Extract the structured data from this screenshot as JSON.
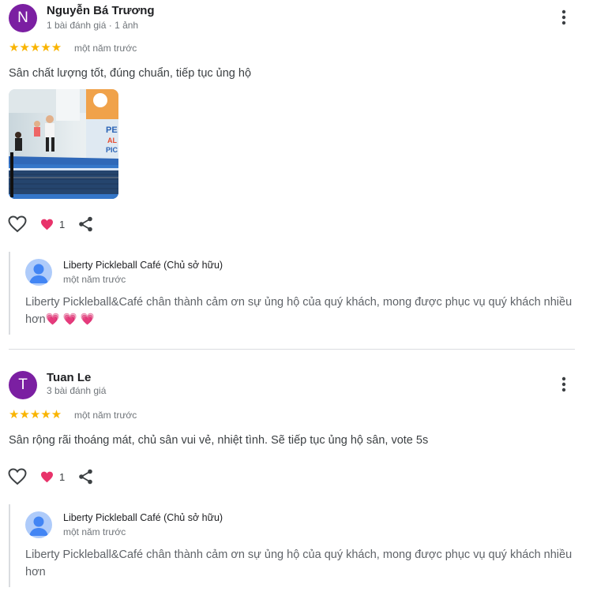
{
  "colors": {
    "avatar_bg": "#7b1fa2",
    "star": "#f9b400",
    "heart": "#e8336a",
    "owner_avatar_bg": "#aecbfa",
    "owner_avatar_fg": "#4285f4"
  },
  "reviews": [
    {
      "avatar_letter": "N",
      "author": "Nguyễn Bá Trương",
      "meta": "1 bài đánh giá · 1 ảnh",
      "rating": 5,
      "stars": "★★★★★",
      "time": "một năm trước",
      "text": "Sân chất lượng tốt, đúng chuẩn, tiếp tục ủng hộ",
      "has_photo": true,
      "reaction_count": "1",
      "reply": {
        "owner": "Liberty Pickleball Café (Chủ sở hữu)",
        "time": "một năm trước",
        "text": "Liberty Pickleball&Café chân thành cảm ơn sự ủng hộ của quý khách, mong được phục vụ quý khách nhiều hơn💗 💗 💗"
      }
    },
    {
      "avatar_letter": "T",
      "author": "Tuan Le",
      "meta": "3 bài đánh giá",
      "rating": 5,
      "stars": "★★★★★",
      "time": "một năm trước",
      "text": "Sân rộng rãi thoáng mát, chủ sân vui vẻ, nhiệt tình. Sẽ tiếp tục ủng hộ sân, vote 5s",
      "has_photo": false,
      "reaction_count": "1",
      "reply": {
        "owner": "Liberty Pickleball Café (Chủ sở hữu)",
        "time": "một năm trước",
        "text": "Liberty Pickleball&Café chân thành cảm ơn sự ủng hộ của quý khách, mong được phục vụ quý khách nhiều hơn"
      }
    }
  ]
}
